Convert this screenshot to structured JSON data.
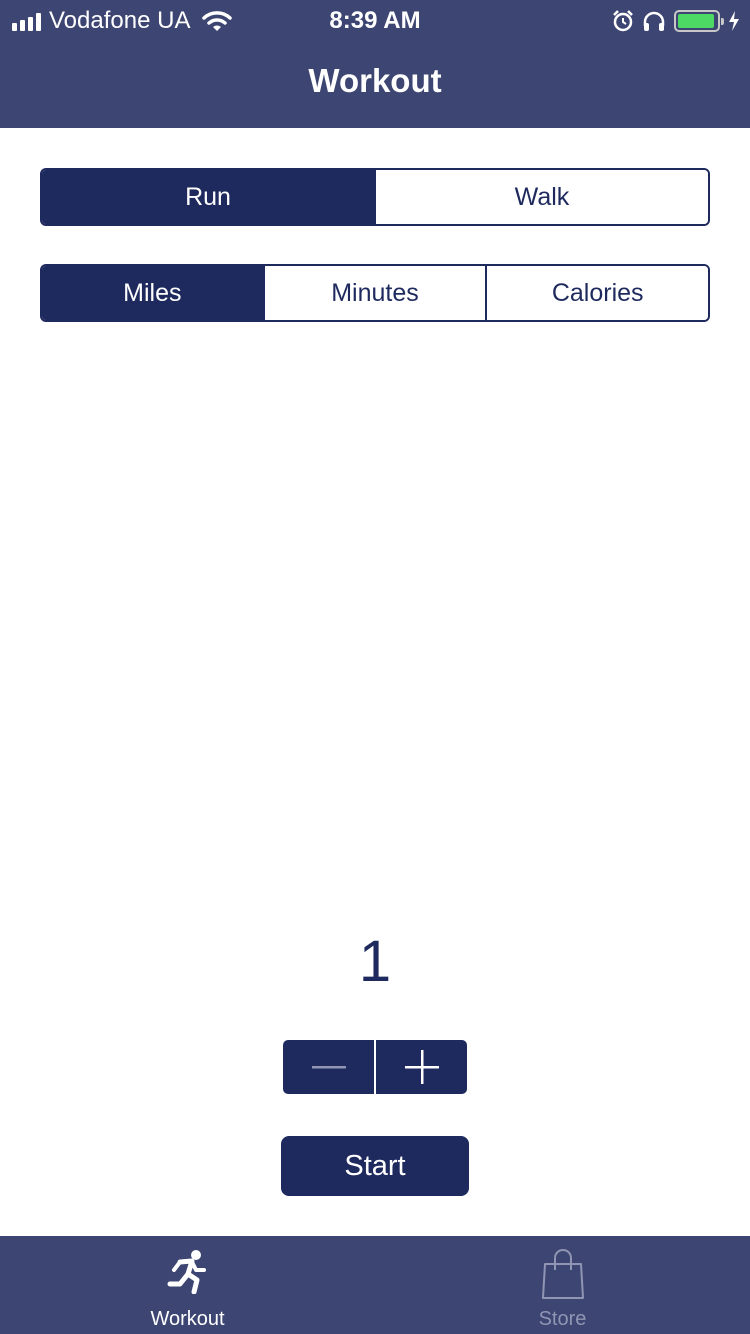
{
  "status_bar": {
    "carrier": "Vodafone UA",
    "time": "8:39 AM",
    "battery_level": 0.95,
    "icons": [
      "signal-icon",
      "wifi-icon",
      "alarm-icon",
      "headphones-icon",
      "battery-icon",
      "charging-bolt-icon"
    ]
  },
  "nav": {
    "title": "Workout"
  },
  "activity_type": {
    "options": [
      "Run",
      "Walk"
    ],
    "selected": "Run"
  },
  "unit": {
    "options": [
      "Miles",
      "Minutes",
      "Calories"
    ],
    "selected": "Miles"
  },
  "target": {
    "value": "1"
  },
  "stepper": {
    "icons": [
      "minus-icon",
      "plus-icon"
    ]
  },
  "start_button": {
    "label": "Start"
  },
  "tab_bar": {
    "tabs": [
      {
        "label": "Workout",
        "icon": "runner-icon",
        "active": true
      },
      {
        "label": "Store",
        "icon": "shopping-bag-icon",
        "active": false
      }
    ]
  },
  "colors": {
    "header": "#3d4672",
    "accent": "#1e2a5e",
    "battery": "#4cd964",
    "inactive_tab": "#8f95b3"
  }
}
